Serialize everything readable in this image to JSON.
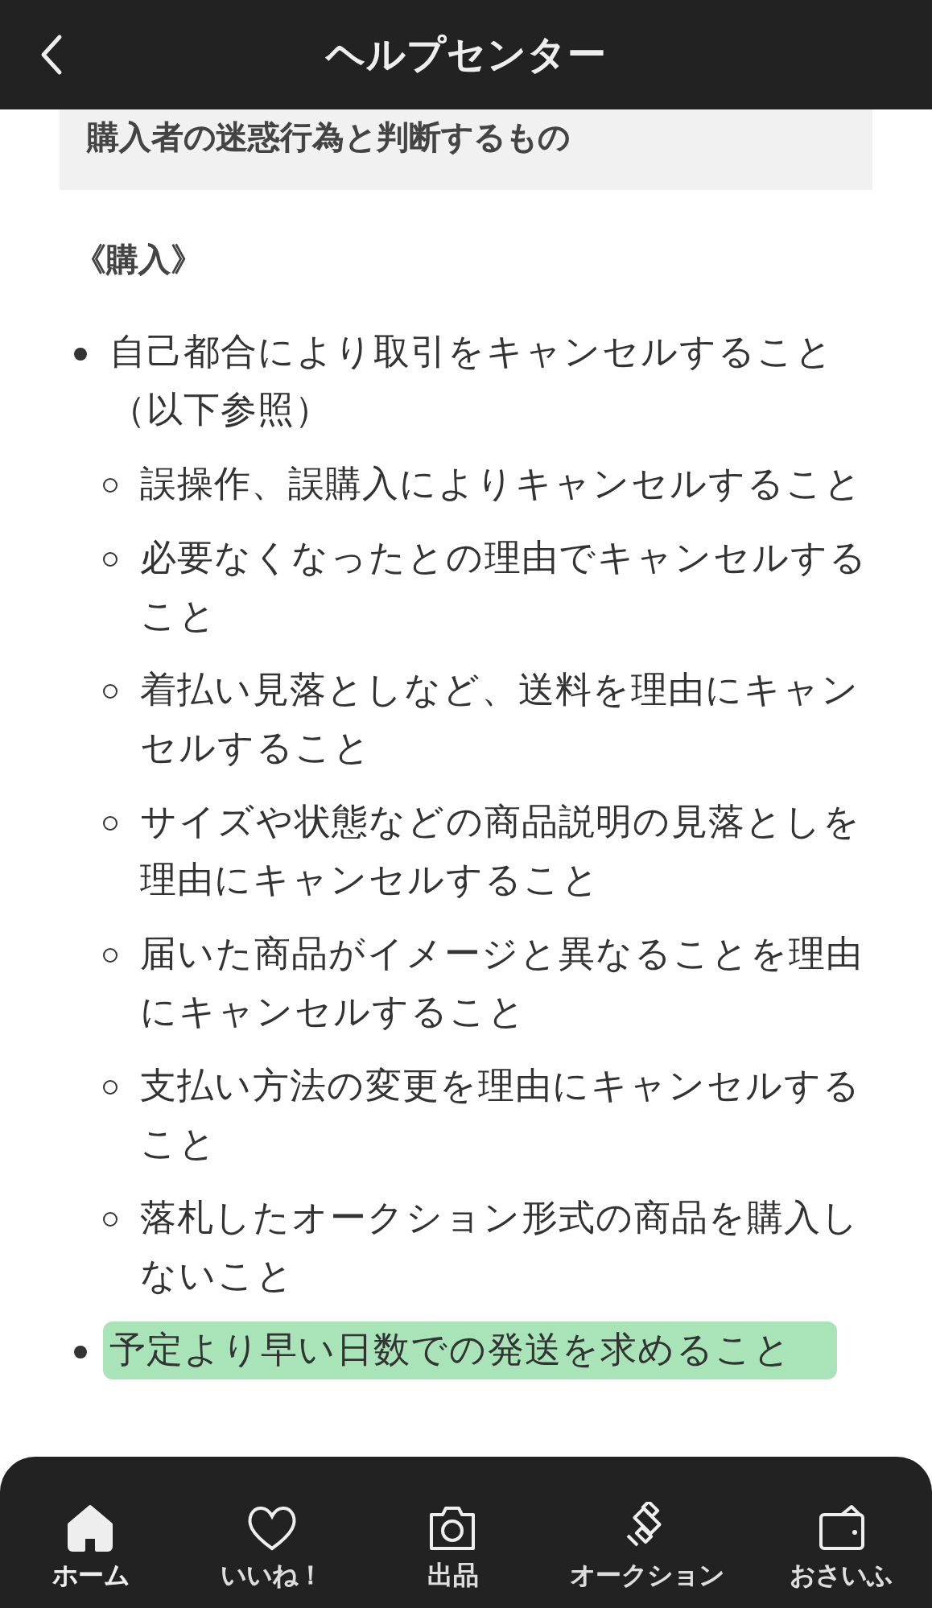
{
  "header": {
    "title": "ヘルプセンター"
  },
  "section_heading": "購入者の迷惑行為と判断するもの",
  "subheading": "《購入》",
  "items": [
    {
      "text": "自己都合により取引をキャンセルすること（以下参照）",
      "highlighted": false,
      "children": [
        {
          "text": "誤操作、誤購入によりキャンセルすること"
        },
        {
          "text": "必要なくなったとの理由でキャンセルすること"
        },
        {
          "text": "着払い見落としなど、送料を理由にキャンセルすること"
        },
        {
          "text": "サイズや状態などの商品説明の見落としを理由にキャンセルすること"
        },
        {
          "text": "届いた商品がイメージと異なることを理由にキャンセルすること"
        },
        {
          "text": "支払い方法の変更を理由にキャンセルすること"
        },
        {
          "text": "落札したオークション形式の商品を購入しないこと"
        }
      ]
    },
    {
      "text": "予定より早い日数での発送を求めること",
      "highlighted": true
    }
  ],
  "bottom_nav": [
    {
      "kind": "home",
      "label": "ホーム",
      "selected": true
    },
    {
      "kind": "like",
      "label": "いいね！",
      "selected": false
    },
    {
      "kind": "sell",
      "label": "出品",
      "selected": false
    },
    {
      "kind": "auction",
      "label": "オークション",
      "selected": false
    },
    {
      "kind": "wallet",
      "label": "おさいふ",
      "selected": false
    }
  ]
}
